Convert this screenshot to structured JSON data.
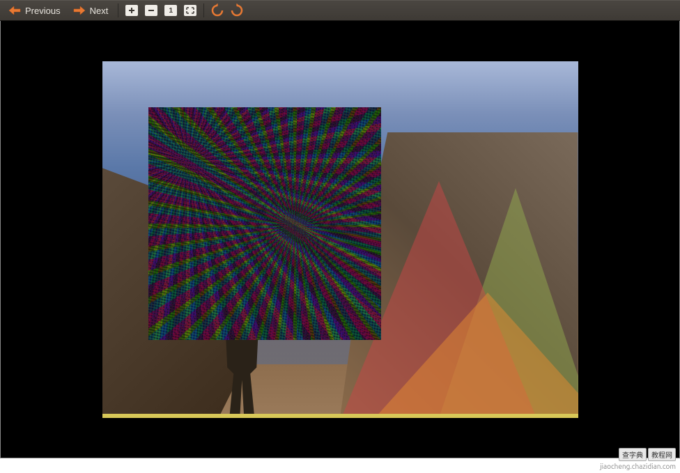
{
  "toolbar": {
    "previous_label": "Previous",
    "next_label": "Next",
    "zoom_in_label": "Zoom In",
    "zoom_out_label": "Zoom Out",
    "zoom_normal_label": "Normal Size",
    "zoom_fit_label": "Best Fit",
    "zoom_normal_symbol": "1",
    "rotate_left_label": "Rotate Left",
    "rotate_right_label": "Rotate Right"
  },
  "colors": {
    "accent_orange": "#e87933",
    "toolbar_bg": "#3e3a35",
    "viewer_bg": "#000000"
  },
  "image": {
    "has_noise_overlay": true,
    "has_triangle_overlays": true,
    "triangle_colors": [
      "red",
      "yellow-green",
      "orange"
    ]
  },
  "watermark": {
    "badge1": "查字典",
    "badge2": "教程网",
    "url": "jiaocheng.chazidian.com"
  }
}
